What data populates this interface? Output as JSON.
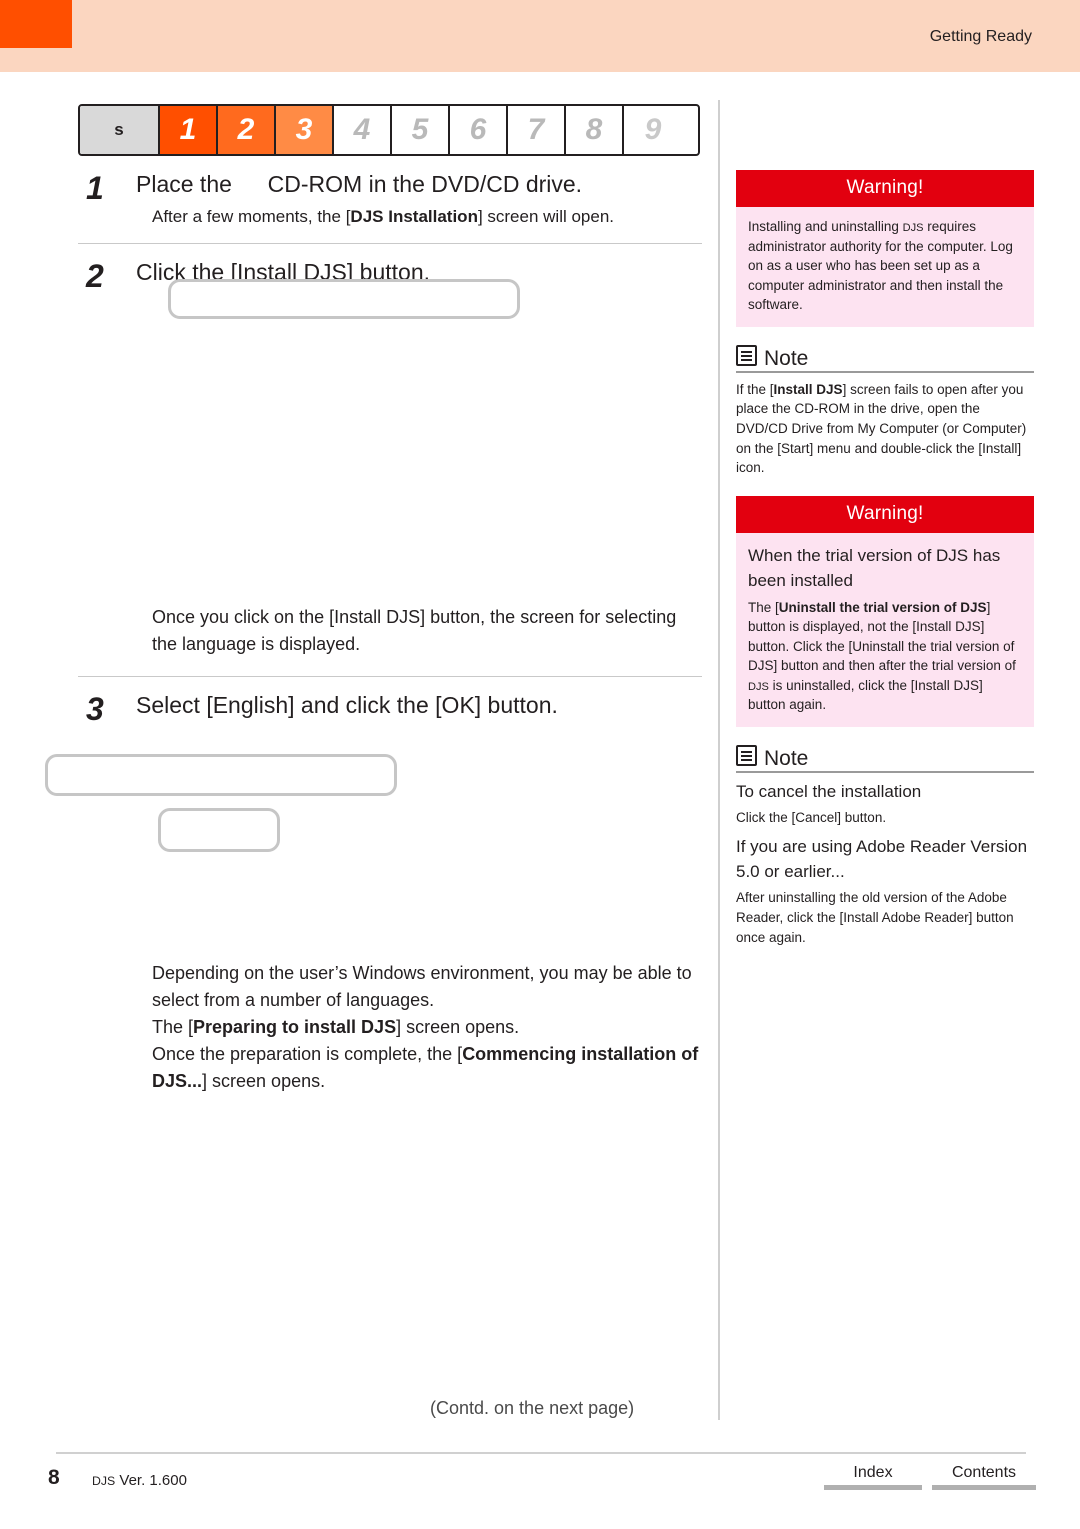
{
  "header": {
    "section_title": "Getting Ready"
  },
  "tabbar": {
    "label": "s",
    "steps": [
      "1",
      "2",
      "3",
      "4",
      "5",
      "6",
      "7",
      "8",
      "9"
    ]
  },
  "steps": [
    {
      "num": "1",
      "title": "Place the    CD-ROM in the DVD/CD drive.",
      "sub_pre": "After a few moments, the [",
      "sub_bold": "DJS Installation",
      "sub_post": "] screen will open."
    },
    {
      "num": "2",
      "title": "Click the [Install DJS] button.",
      "body": "Once you click on the [Install DJS] button, the screen for selecting the language is displayed."
    },
    {
      "num": "3",
      "title": "Select [English] and click the [OK] button.",
      "body_line1": "Depending on the user’s Windows environment, you may be able to select from a number of languages.",
      "body_line2_pre": "The [",
      "body_line2_bold": "Preparing to install DJS",
      "body_line2_post": "] screen opens.",
      "body_line3_pre": "Once the preparation is complete, the [",
      "body_line3_bold": "Commencing installation of DJS...",
      "body_line3_post": "] screen opens."
    }
  ],
  "sidebar": {
    "warning1": {
      "title": "Warning!",
      "body_pre": "Installing and uninstalling ",
      "body_djs": "DJS",
      "body_post": " requires administrator authority for the computer. Log on as a user who has been set up as a computer administrator and then install the software."
    },
    "note1": {
      "title": "Note",
      "line_pre": "If the [",
      "line_bold": "Install DJS",
      "line_post": "] screen fails to open after you place the CD-ROM in the drive, open the DVD/CD Drive from My Computer (or Computer) on the [Start] menu and double-click the [Install] icon."
    },
    "warning2": {
      "title": "Warning!",
      "heading": "When the trial version of DJS has been installed",
      "body_pre": "The [",
      "body_bold": "Uninstall the trial version of DJS",
      "body_mid": "] button is displayed, not the [Install DJS] button. Click the [Uninstall the trial version of DJS] button and then after the trial version of ",
      "body_djs": "DJS",
      "body_post": " is uninstalled, click the [Install DJS] button again."
    },
    "note2": {
      "title": "Note",
      "head1": "To cancel the installation",
      "body1": "Click the [Cancel] button.",
      "head2": "If you are using Adobe Reader Version 5.0 or earlier...",
      "body2": "After uninstalling the old version of the Adobe Reader, click the [Install Adobe Reader] button once again."
    }
  },
  "footer": {
    "contd": "(Contd. on the next page)",
    "page_number": "8",
    "version_djs": "DJS",
    "version_text": " Ver. 1.600",
    "index_label": "Index",
    "contents_label": "Contents"
  }
}
